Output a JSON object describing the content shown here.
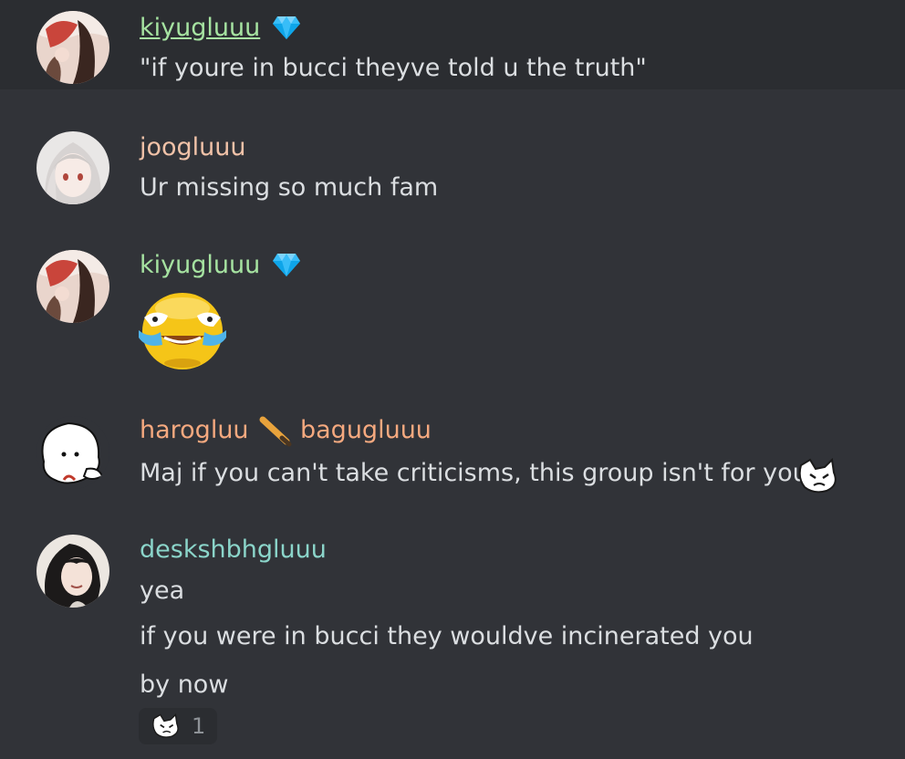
{
  "messages": [
    {
      "username": "kiyugluuu",
      "username_color": "#a6e3a1",
      "badge_icon": "diamond-icon",
      "lines": [
        "\"if youre in bucci theyve told u the truth\""
      ]
    },
    {
      "username": "joogluuu",
      "username_color": "#f0c2a8",
      "lines": [
        "Ur missing so much fam"
      ]
    },
    {
      "username": "kiyugluuu",
      "username_color": "#a6e3a1",
      "badge_icon": "diamond-icon",
      "emoji": "laughing-crying-face-emoji"
    },
    {
      "username": "harogluu",
      "username_color": "#f5a97f",
      "badge_icon": "pencil-icon",
      "secondary_name": "bagugluuu",
      "secondary_color": "#f5a97f",
      "lines": [
        "Maj if you can't take criticisms, this group isn't for you"
      ],
      "trailing_emoji": "cat-emoji"
    },
    {
      "username": "deskshbhgluuu",
      "username_color": "#8bd5ca",
      "lines": [
        "yea",
        "if you were in bucci they wouldve incinerated you",
        "by now"
      ],
      "reaction": {
        "icon": "cat-emoji",
        "count": "1"
      }
    }
  ],
  "colors": {
    "background": "#313338",
    "highlight": "#2b2d31",
    "text": "#dbdee1",
    "diamond": "#38bdf8",
    "emoji_yellow": "#f5c518",
    "pencil": "#e8a33c"
  }
}
